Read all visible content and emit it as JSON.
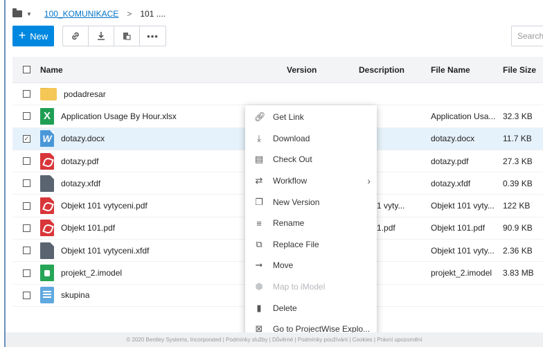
{
  "breadcrumb": {
    "root": "100_KOMUNIKACE",
    "separator": ">",
    "current": "101 ...."
  },
  "toolbar": {
    "new_label": "New",
    "search_placeholder": "Search"
  },
  "table": {
    "headers": {
      "name": "Name",
      "version": "Version",
      "description": "Description",
      "file_name": "File Name",
      "file_size": "File Size"
    },
    "rows": [
      {
        "name": "podadresar",
        "icon": "folder-icon",
        "description": "",
        "file_name": "",
        "file_size": "",
        "checked": false
      },
      {
        "name": "Application Usage By Hour.xlsx",
        "icon": "excel-icon",
        "description": "",
        "file_name": "Application Usa...",
        "file_size": "32.3 KB",
        "checked": false
      },
      {
        "name": "dotazy.docx",
        "icon": "word-icon",
        "description": "",
        "file_name": "dotazy.docx",
        "file_size": "11.7 KB",
        "checked": true
      },
      {
        "name": "dotazy.pdf",
        "icon": "pdf-icon",
        "description": "y.pdf",
        "file_name": "dotazy.pdf",
        "file_size": "27.3 KB",
        "checked": false
      },
      {
        "name": "dotazy.xfdf",
        "icon": "xfdf-icon",
        "description": "",
        "file_name": "dotazy.xfdf",
        "file_size": "0.39 KB",
        "checked": false
      },
      {
        "name": "Objekt 101 vytyceni.pdf",
        "icon": "pdf-icon",
        "description": "kt 101 vyty...",
        "file_name": "Objekt 101 vyty...",
        "file_size": "122 KB",
        "checked": false
      },
      {
        "name": "Objekt 101.pdf",
        "icon": "pdf-icon",
        "description": "kt 101.pdf",
        "file_name": "Objekt 101.pdf",
        "file_size": "90.9 KB",
        "checked": false
      },
      {
        "name": "Objekt 101 vytyceni.xfdf",
        "icon": "xfdf-icon",
        "description": "",
        "file_name": "Objekt 101 vyty...",
        "file_size": "2.36 KB",
        "checked": false
      },
      {
        "name": "projekt_2.imodel",
        "icon": "imodel-icon",
        "description": "",
        "file_name": "projekt_2.imodel",
        "file_size": "3.83 MB",
        "checked": false
      },
      {
        "name": "skupina",
        "icon": "group-icon",
        "description": "",
        "file_name": "",
        "file_size": "",
        "checked": false
      }
    ]
  },
  "context_menu": [
    {
      "label": "Get Link",
      "icon": "link-icon",
      "enabled": true
    },
    {
      "label": "Download",
      "icon": "download-icon",
      "enabled": true
    },
    {
      "label": "Check Out",
      "icon": "checkout-icon",
      "enabled": true
    },
    {
      "label": "Workflow",
      "icon": "workflow-icon",
      "enabled": true,
      "submenu": true
    },
    {
      "label": "New Version",
      "icon": "new-version-icon",
      "enabled": true
    },
    {
      "label": "Rename",
      "icon": "rename-icon",
      "enabled": true
    },
    {
      "label": "Replace File",
      "icon": "replace-file-icon",
      "enabled": true
    },
    {
      "label": "Move",
      "icon": "move-icon",
      "enabled": true
    },
    {
      "label": "Map to iModel",
      "icon": "map-imodel-icon",
      "enabled": false
    },
    {
      "label": "Delete",
      "icon": "delete-icon",
      "enabled": true
    },
    {
      "label": "Go to ProjectWise Explo...",
      "icon": "projectwise-icon",
      "enabled": true
    }
  ],
  "footer": {
    "text": "© 2020 Bentley Systems, Incorporated | Podmínky služby | Důvěrné | Podmínky používání | Cookies | Právní upozornění"
  },
  "colors": {
    "accent": "#0088e0",
    "link": "#0072c6",
    "selected_row": "#e6f2fb"
  }
}
